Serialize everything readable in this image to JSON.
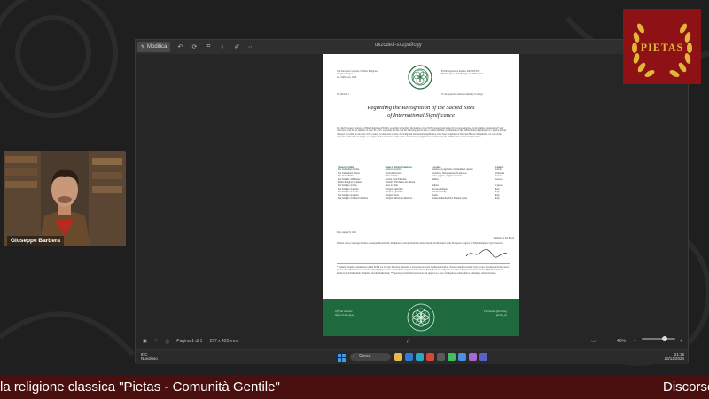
{
  "share_window": {
    "toolbar_button": "Modifica",
    "title": "ukzcde3-sxzpa9cgy"
  },
  "document": {
    "org_line1": "The European Congress of Ethnic Religions",
    "org_line2": "info@ecer-org.eu",
    "org_line3": "est. 1998, reest. 2016",
    "reg_line1": "ECER registration number: 40008533534",
    "reg_line2": "Brivibas gatve 394-48, Riga, LV-1006, Latvia",
    "ref": "N° 2024-08-1",
    "to": "To the respective national authority in charge",
    "title_line1": "Regarding the Recognition of the Sacred Sites",
    "title_line2": "of International Significance",
    "body": "We, the European Congress of Ethnic Religions (ECER), according to the Riga Declaration of the ECER adopted and signed by its representatives, both member organisations* and observers, from 4th of summer on June 30, 2023, we hereby declare that the following sacred sites, to which member communities of the faithful make pilgrimages for a special manner of prayer according to the rites of the country, be thus seen as sites of worship and international significance, have been designated as National Historic Monuments, we call on the respective authorities in charge to recognise at the national level the status of international significance conferred by the ECER on the sacred sites listed here.",
    "table": {
      "headers": [
        "Name in English",
        "Name in original language",
        "Location",
        "Country"
      ],
      "rows": [
        [
          "The Lithuanian Shrine",
          "Lietuvos sventove",
          "Sventosios pagrindas, Sakmonkiesi rajonas",
          "Latvia"
        ],
        [
          "The Samogitian Shrine",
          "Sventoji Sventove",
          "Kvedarna, Sileto rajonas, Sventosios",
          "Lithuania"
        ],
        [
          "The Swiss Shrine",
          "Sibsa ermitas",
          "Sakas pagasts, Jelgavas novads",
          "Latvia"
        ],
        [
          "The Temple of Hellenic",
          "Iereion Sonit Ellenikis",
          "Athina",
          "Greece"
        ],
        [
          "Ethnic Religion in Athens",
          "Ellenikis Thriskeias stin Athina",
          "",
          ""
        ],
        [
          "The Temple of Zeus",
          "Naos tou Dia",
          "Athens",
          "Cyprus"
        ],
        [
          "The Temple of Apollo",
          "Templum Apollinis",
          "Nicosia, Tempio",
          "Italy"
        ],
        [
          "The Temple of Apollo",
          "Templum Apollinis",
          "Palermo, Sicily",
          "Italy"
        ],
        [
          "The Temple of Jupiter",
          "Templum Iovis",
          "Roma",
          "Italy"
        ],
        [
          "The Temple of Minerva Medica",
          "Templum Minervae Medicae",
          "Roma/Ardinella, Scisi Frinana Gioda",
          "Italy"
        ]
      ]
    },
    "date": "Riga, August 8, 2024",
    "signatories": "Daniela Liowe, Giuseppe Barbera, Giuseppe Morelli, Inn. Durkinstan, Ludwig Montreuil, Reno Tkacik, and President of the European Congress of Ethnic Religions Ugis Nastevics",
    "board_label": "Members of the Board",
    "note": "* Namely: member organisations of the ECER are Latvijas Dievturu sadraudze, Latvia; Associazione Tradizionale Pietas - Pietas Comunita Gentile, Italy; Grupo Dresdijas de Kotka Teoto; De Asociatie Heidense Gemeenschap; Nordic Pagan Network; Ydalir, Society; Ukrainian Native Faith; Romuva, Lithuania; Gurudvara Pagan; Supreme Council of Ethnic Hellenes; Rodnovery, Polish; Dianic Bohemia; and the Netherlands. ** Special governmental protection and support as a part of indigenous culture, that is humanity's cultural heritage.",
    "footer_left_1": "Official website:",
    "footer_left_2": "https://ecer-org.eu",
    "footer_right_1": "Facebook: @ecer.org",
    "footer_right_2": "@ecer_eu"
  },
  "viewer_bar": {
    "page_info": "Pagina 1 di 1",
    "size_info": "297 x 420 mm",
    "zoom": "46%"
  },
  "taskbar": {
    "weather_temp": "8°C",
    "weather_desc": "Nuvoloso",
    "search": "Cerca",
    "time": "21:16",
    "date": "20/12/2024"
  },
  "webcam": {
    "name": "Giuseppe Barbera"
  },
  "logo": {
    "text": "PIETAS"
  },
  "ticker": {
    "left": "la religione classica \"Pietas - Comunità Gentile\"",
    "right": "Discorso"
  },
  "colors": {
    "doc_green": "#1e6a3e",
    "logo_red": "#8e1116",
    "logo_gold": "#e2b63a",
    "ticker_bg": "#4a1010"
  }
}
